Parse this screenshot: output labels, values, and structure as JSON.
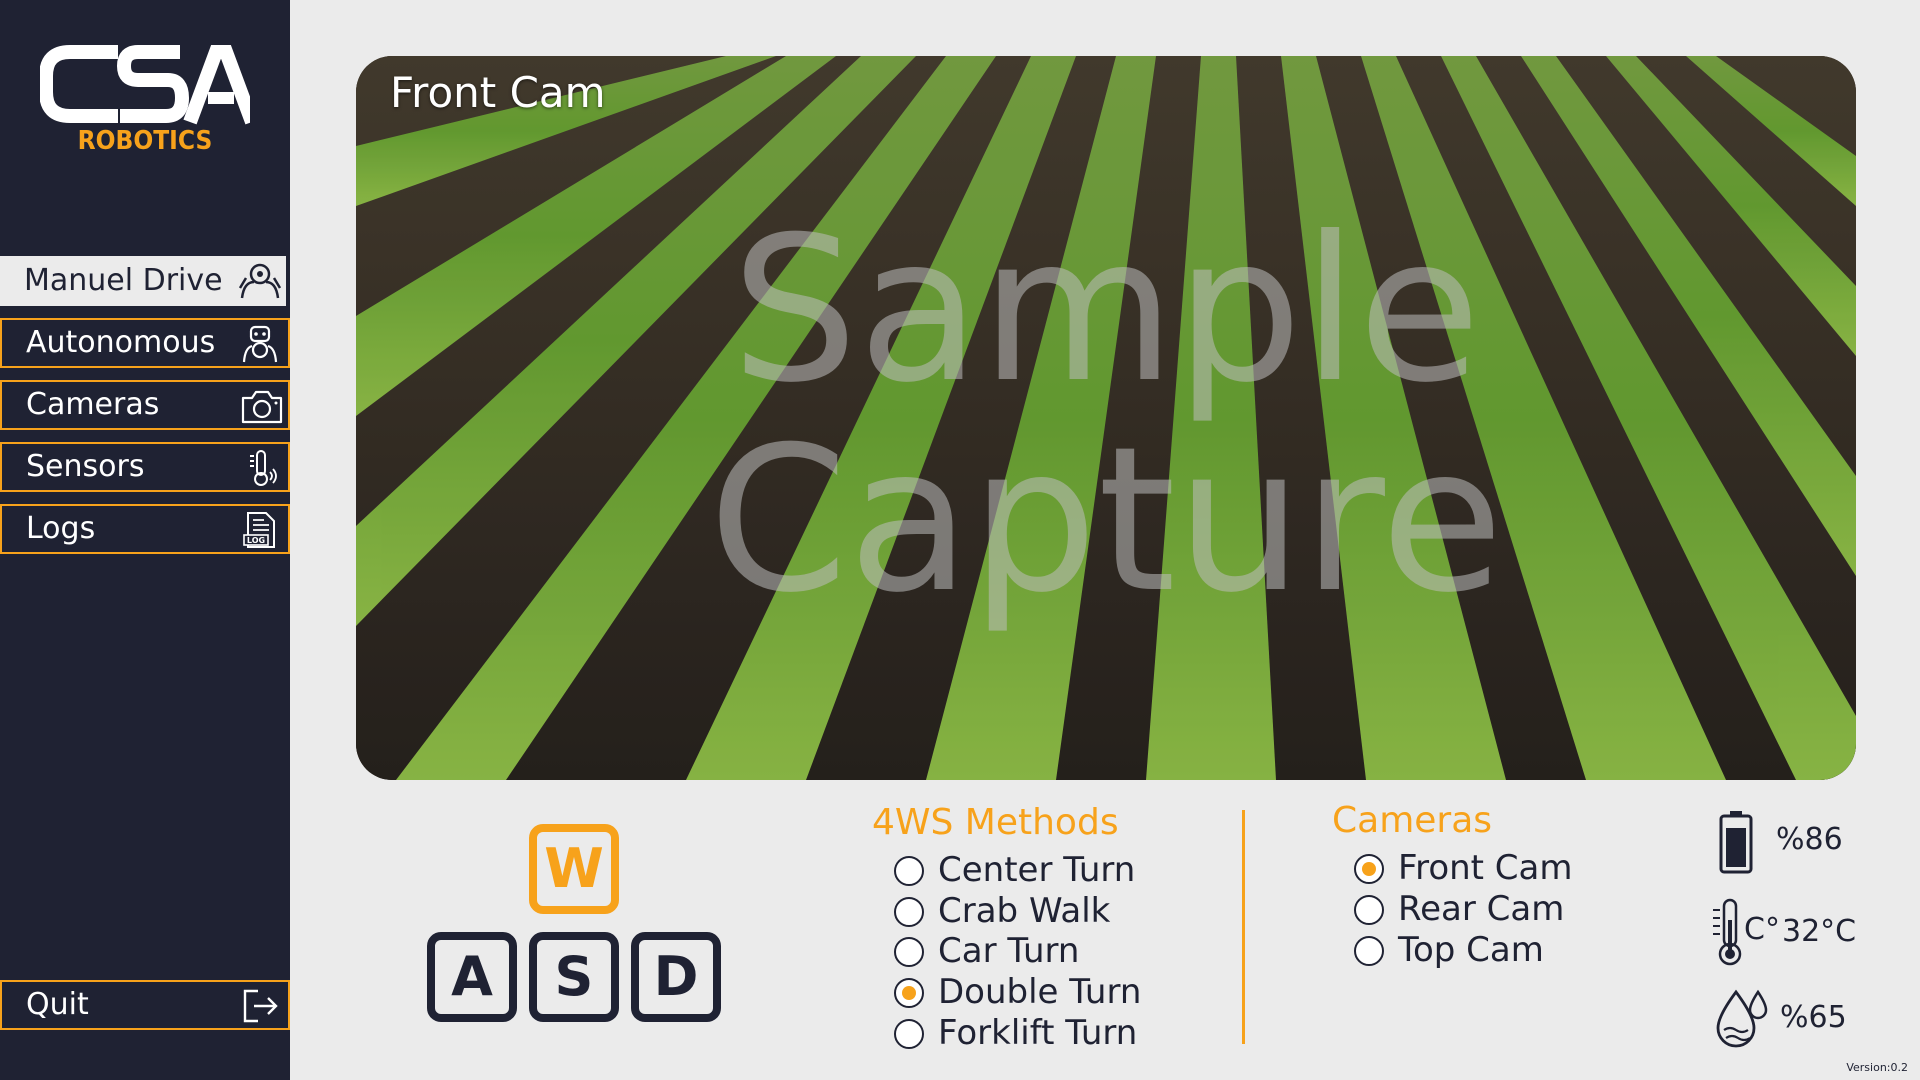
{
  "brand": {
    "logo_text": "CSA",
    "logo_subtitle": "ROBOTICS"
  },
  "sidebar": {
    "items": [
      {
        "label": "Manuel Drive",
        "icon": "steering-wheel-icon",
        "active": true
      },
      {
        "label": "Autonomous",
        "icon": "robot-driver-icon",
        "active": false
      },
      {
        "label": "Cameras",
        "icon": "camera-icon",
        "active": false
      },
      {
        "label": "Sensors",
        "icon": "thermometer-icon",
        "active": false
      },
      {
        "label": "Logs",
        "icon": "log-file-icon",
        "active": false
      }
    ],
    "quit_label": "Quit"
  },
  "camera_view": {
    "title": "Front Cam",
    "watermark_line1": "Sample",
    "watermark_line2": "Capture"
  },
  "keyboard": {
    "keys": [
      "W",
      "A",
      "S",
      "D"
    ],
    "highlighted": "W"
  },
  "steering_methods": {
    "title": "4WS Methods",
    "options": [
      {
        "label": "Center Turn",
        "selected": false
      },
      {
        "label": "Crab Walk",
        "selected": false
      },
      {
        "label": "Car Turn",
        "selected": false
      },
      {
        "label": "Double Turn",
        "selected": true
      },
      {
        "label": "Forklift Turn",
        "selected": false
      }
    ]
  },
  "cameras": {
    "title": "Cameras",
    "options": [
      {
        "label": "Front Cam",
        "selected": true
      },
      {
        "label": "Rear Cam",
        "selected": false
      },
      {
        "label": "Top Cam",
        "selected": false
      }
    ]
  },
  "status": {
    "battery": "%86",
    "temperature": "32°C",
    "temperature_unit_icon": "C°",
    "humidity": "%65"
  },
  "version": "Version:0.2",
  "colors": {
    "sidebar_bg": "#1f2233",
    "accent": "#f7a21b",
    "page_bg": "#ebebeb"
  }
}
